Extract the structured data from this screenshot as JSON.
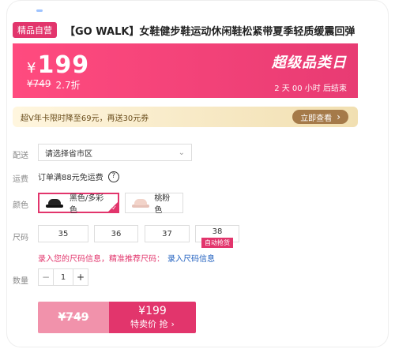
{
  "header": {
    "tag_label": "精品自营",
    "title": "【GO WALK】女鞋健步鞋运动休闲鞋松紧带夏季轻质缓震回弹"
  },
  "price_banner": {
    "currency": "¥",
    "current_price": "199",
    "original_price": "¥749",
    "discount": "2.7折",
    "promo_title": "超级品类日",
    "countdown_text": "2 天 00 小时 后结束"
  },
  "vip_strip": {
    "text": "超V年卡限时降至69元，再送30元券",
    "button_label": "立即查看",
    "button_chevron": "›"
  },
  "delivery": {
    "label": "配送",
    "select_value": "请选择省市区",
    "chevron": "⌄"
  },
  "freight": {
    "label": "运费",
    "text": "订单满88元免运费",
    "help_icon": "?"
  },
  "colors": {
    "label": "颜色",
    "options": [
      {
        "label": "黑色/多彩色",
        "icon": "black-shoe-icon",
        "selected": true
      },
      {
        "label": "桃粉色",
        "icon": "pink-shoe-icon",
        "selected": false
      }
    ]
  },
  "sizes": {
    "label": "尺码",
    "options": [
      {
        "value": "35"
      },
      {
        "value": "36"
      },
      {
        "value": "37"
      },
      {
        "value": "38",
        "badge": "自动抢货"
      }
    ]
  },
  "size_hint": {
    "text": "录入您的尺码信息，精准推荐尺码：",
    "link": "录入尺码信息"
  },
  "quantity": {
    "label": "数量",
    "minus": "−",
    "value": "1",
    "plus": "+"
  },
  "buy_bar": {
    "original_price": "¥749",
    "sale_price": "¥199",
    "sale_label": "特卖价 抢",
    "chevron": "›"
  },
  "theme": {
    "accent": "#e2356c",
    "vip_brown": "#a57a49",
    "link_blue": "#1f5fbf"
  }
}
